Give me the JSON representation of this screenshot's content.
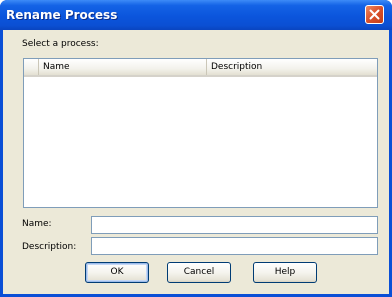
{
  "window": {
    "title": "Rename Process"
  },
  "form": {
    "select_label": "Select a process:",
    "columns": [
      "Name",
      "Description"
    ],
    "name_label": "Name:",
    "name_value": "",
    "description_label": "Description:",
    "description_value": ""
  },
  "buttons": {
    "ok": "OK",
    "cancel": "Cancel",
    "help": "Help"
  },
  "colors": {
    "titlebar": "#0b55dc",
    "dialog_bg": "#ece9d8",
    "close_button": "#d9502a",
    "field_border": "#7f9db9"
  },
  "icons": {
    "close": "close-icon"
  }
}
